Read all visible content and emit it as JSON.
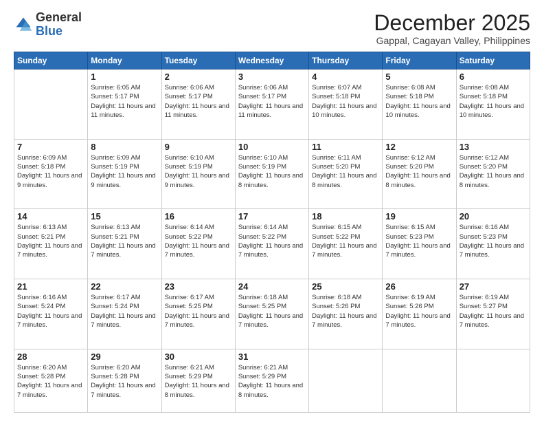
{
  "logo": {
    "general": "General",
    "blue": "Blue"
  },
  "header": {
    "title": "December 2025",
    "subtitle": "Gappal, Cagayan Valley, Philippines"
  },
  "weekdays": [
    "Sunday",
    "Monday",
    "Tuesday",
    "Wednesday",
    "Thursday",
    "Friday",
    "Saturday"
  ],
  "weeks": [
    [
      {
        "day": "",
        "empty": true
      },
      {
        "day": "1",
        "sunrise": "6:05 AM",
        "sunset": "5:17 PM",
        "daylight": "11 hours and 11 minutes."
      },
      {
        "day": "2",
        "sunrise": "6:06 AM",
        "sunset": "5:17 PM",
        "daylight": "11 hours and 11 minutes."
      },
      {
        "day": "3",
        "sunrise": "6:06 AM",
        "sunset": "5:17 PM",
        "daylight": "11 hours and 11 minutes."
      },
      {
        "day": "4",
        "sunrise": "6:07 AM",
        "sunset": "5:18 PM",
        "daylight": "11 hours and 10 minutes."
      },
      {
        "day": "5",
        "sunrise": "6:08 AM",
        "sunset": "5:18 PM",
        "daylight": "11 hours and 10 minutes."
      },
      {
        "day": "6",
        "sunrise": "6:08 AM",
        "sunset": "5:18 PM",
        "daylight": "11 hours and 10 minutes."
      }
    ],
    [
      {
        "day": "7",
        "sunrise": "6:09 AM",
        "sunset": "5:18 PM",
        "daylight": "11 hours and 9 minutes."
      },
      {
        "day": "8",
        "sunrise": "6:09 AM",
        "sunset": "5:19 PM",
        "daylight": "11 hours and 9 minutes."
      },
      {
        "day": "9",
        "sunrise": "6:10 AM",
        "sunset": "5:19 PM",
        "daylight": "11 hours and 9 minutes."
      },
      {
        "day": "10",
        "sunrise": "6:10 AM",
        "sunset": "5:19 PM",
        "daylight": "11 hours and 8 minutes."
      },
      {
        "day": "11",
        "sunrise": "6:11 AM",
        "sunset": "5:20 PM",
        "daylight": "11 hours and 8 minutes."
      },
      {
        "day": "12",
        "sunrise": "6:12 AM",
        "sunset": "5:20 PM",
        "daylight": "11 hours and 8 minutes."
      },
      {
        "day": "13",
        "sunrise": "6:12 AM",
        "sunset": "5:20 PM",
        "daylight": "11 hours and 8 minutes."
      }
    ],
    [
      {
        "day": "14",
        "sunrise": "6:13 AM",
        "sunset": "5:21 PM",
        "daylight": "11 hours and 7 minutes."
      },
      {
        "day": "15",
        "sunrise": "6:13 AM",
        "sunset": "5:21 PM",
        "daylight": "11 hours and 7 minutes."
      },
      {
        "day": "16",
        "sunrise": "6:14 AM",
        "sunset": "5:22 PM",
        "daylight": "11 hours and 7 minutes."
      },
      {
        "day": "17",
        "sunrise": "6:14 AM",
        "sunset": "5:22 PM",
        "daylight": "11 hours and 7 minutes."
      },
      {
        "day": "18",
        "sunrise": "6:15 AM",
        "sunset": "5:22 PM",
        "daylight": "11 hours and 7 minutes."
      },
      {
        "day": "19",
        "sunrise": "6:15 AM",
        "sunset": "5:23 PM",
        "daylight": "11 hours and 7 minutes."
      },
      {
        "day": "20",
        "sunrise": "6:16 AM",
        "sunset": "5:23 PM",
        "daylight": "11 hours and 7 minutes."
      }
    ],
    [
      {
        "day": "21",
        "sunrise": "6:16 AM",
        "sunset": "5:24 PM",
        "daylight": "11 hours and 7 minutes."
      },
      {
        "day": "22",
        "sunrise": "6:17 AM",
        "sunset": "5:24 PM",
        "daylight": "11 hours and 7 minutes."
      },
      {
        "day": "23",
        "sunrise": "6:17 AM",
        "sunset": "5:25 PM",
        "daylight": "11 hours and 7 minutes."
      },
      {
        "day": "24",
        "sunrise": "6:18 AM",
        "sunset": "5:25 PM",
        "daylight": "11 hours and 7 minutes."
      },
      {
        "day": "25",
        "sunrise": "6:18 AM",
        "sunset": "5:26 PM",
        "daylight": "11 hours and 7 minutes."
      },
      {
        "day": "26",
        "sunrise": "6:19 AM",
        "sunset": "5:26 PM",
        "daylight": "11 hours and 7 minutes."
      },
      {
        "day": "27",
        "sunrise": "6:19 AM",
        "sunset": "5:27 PM",
        "daylight": "11 hours and 7 minutes."
      }
    ],
    [
      {
        "day": "28",
        "sunrise": "6:20 AM",
        "sunset": "5:28 PM",
        "daylight": "11 hours and 7 minutes."
      },
      {
        "day": "29",
        "sunrise": "6:20 AM",
        "sunset": "5:28 PM",
        "daylight": "11 hours and 7 minutes."
      },
      {
        "day": "30",
        "sunrise": "6:21 AM",
        "sunset": "5:29 PM",
        "daylight": "11 hours and 8 minutes."
      },
      {
        "day": "31",
        "sunrise": "6:21 AM",
        "sunset": "5:29 PM",
        "daylight": "11 hours and 8 minutes."
      },
      {
        "day": "",
        "empty": true
      },
      {
        "day": "",
        "empty": true
      },
      {
        "day": "",
        "empty": true
      }
    ]
  ],
  "labels": {
    "sunrise": "Sunrise:",
    "sunset": "Sunset:",
    "daylight": "Daylight:"
  }
}
